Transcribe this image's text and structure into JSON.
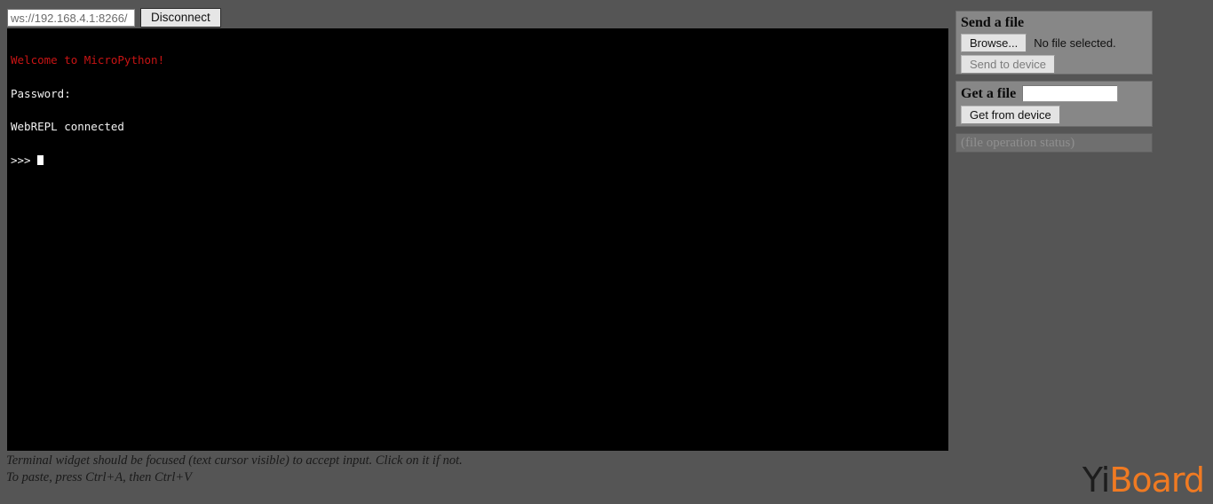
{
  "connection": {
    "url_value": "ws://192.168.4.1:8266/",
    "url_placeholder": "ws://192.168.4.1:8266/",
    "disconnect_label": "Disconnect"
  },
  "terminal": {
    "lines": [
      "Welcome to MicroPython!",
      "Password:",
      "WebREPL connected"
    ],
    "prompt": ">>> ",
    "welcome_color": "#c81414",
    "text_color": "#ffffff",
    "background": "#000000"
  },
  "hints": {
    "line1": "Terminal widget should be focused (text cursor visible) to accept input. Click on it if not.",
    "line2": "To paste, press Ctrl+A, then Ctrl+V"
  },
  "send_file": {
    "title": "Send a file",
    "browse_label": "Browse...",
    "no_file_text": "No file selected.",
    "send_label": "Send to device"
  },
  "get_file": {
    "title": "Get a file",
    "filename_value": "",
    "filename_placeholder": "",
    "get_label": "Get from device"
  },
  "status": {
    "text": "(file operation status)"
  },
  "watermark": {
    "yi": "Yi",
    "board": "Board",
    "brand_color": "#f07a22",
    "dark_color": "#1d1d1d"
  },
  "colors": {
    "page_background": "#555555",
    "panel_background": "#878787"
  }
}
